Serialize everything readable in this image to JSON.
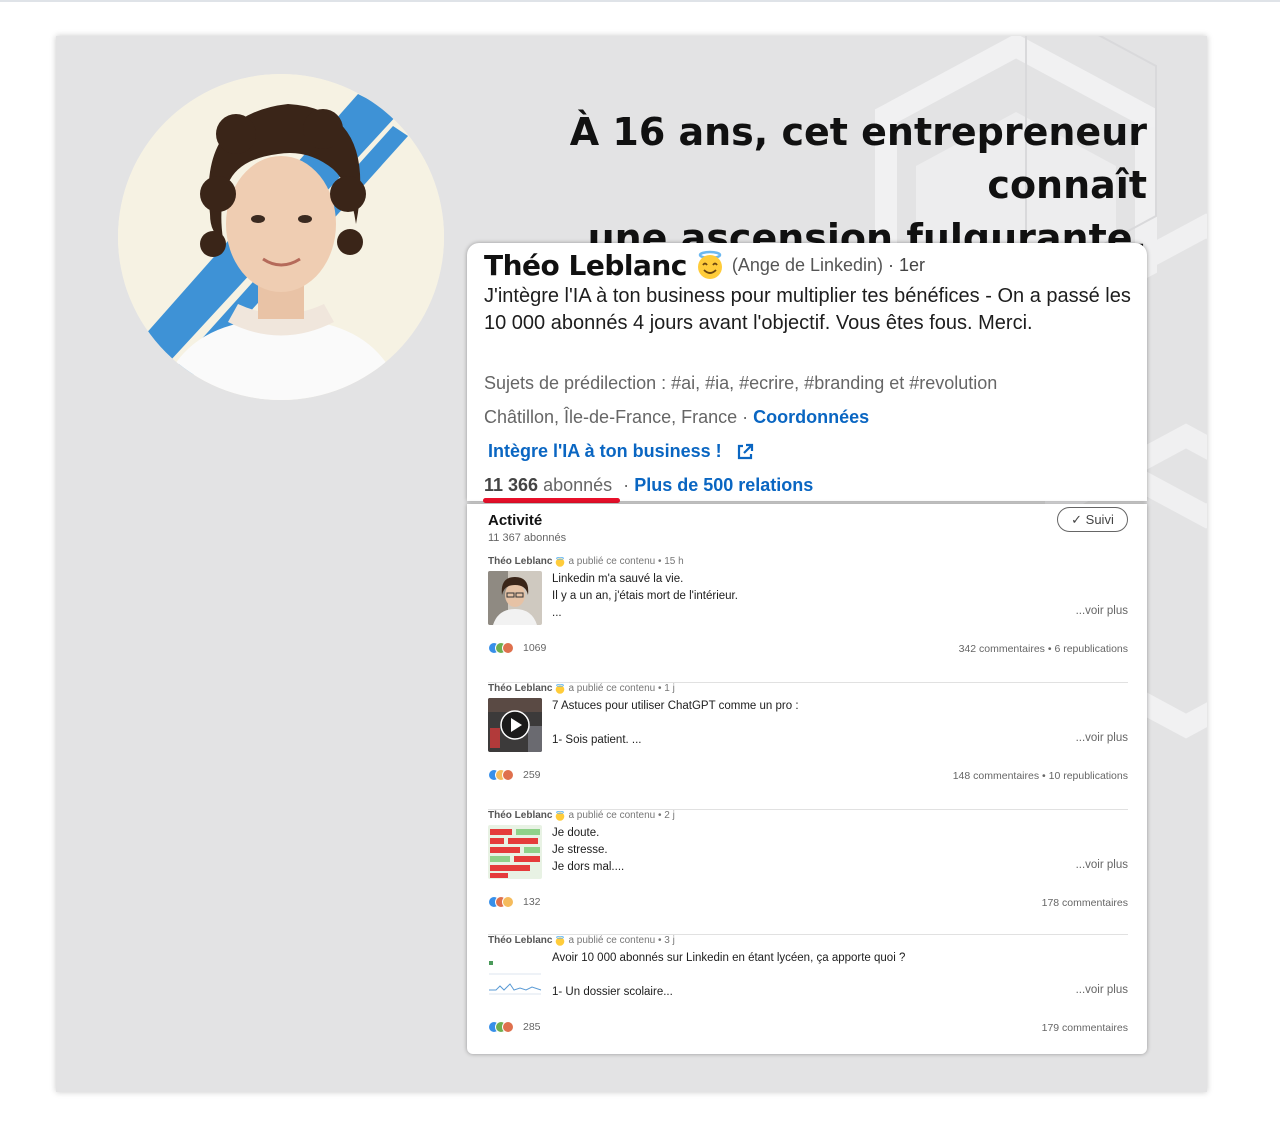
{
  "headline": {
    "line1": "À 16 ans, cet entrepreneur connaît",
    "line2": "une ascension fulgurante."
  },
  "profile": {
    "name": "Théo Leblanc",
    "name_emoji": "smiling-face-with-halo-icon",
    "nickname": "(Ange de Linkedin)",
    "degree": "· 1er",
    "headline_text": "J'intègre l'IA à ton business pour multiplier tes bénéfices - On a passé les 10 000 abonnés 4 jours avant l'objectif. Vous êtes fous. Merci.",
    "topics": "Sujets de prédilection : #ai, #ia, #ecrire, #branding et #revolution",
    "location": "Châtillon, Île-de-France, France ·",
    "contact_link": "Coordonnées",
    "website_link": "Intègre l'IA à ton business !",
    "followers_number": "11 366",
    "followers_label": "abonnés",
    "separator": "·",
    "relations": "Plus de 500 relations"
  },
  "activity": {
    "title": "Activité",
    "followers": "11 367 abonnés",
    "follow_button": "✓ Suivi",
    "posts": [
      {
        "author": "Théo Leblanc",
        "action": "a publié ce contenu",
        "time": "• 15 h",
        "lines": [
          "Linkedin m'a sauvé la vie.",
          "Il y a un an, j'étais mort de l'intérieur.",
          "..."
        ],
        "see_more": "...voir plus",
        "reaction_count": "1069",
        "stats": "342 commentaires • 6 republications"
      },
      {
        "author": "Théo Leblanc",
        "action": "a publié ce contenu",
        "time": "• 1 j",
        "lines": [
          "7 Astuces pour utiliser ChatGPT comme un pro :",
          "",
          "1- Sois patient. ..."
        ],
        "see_more": "...voir plus",
        "reaction_count": "259",
        "stats": "148 commentaires • 10 republications"
      },
      {
        "author": "Théo Leblanc",
        "action": "a publié ce contenu",
        "time": "• 2 j",
        "lines": [
          "Je doute.",
          "Je stresse.",
          "Je dors mal...."
        ],
        "see_more": "...voir plus",
        "reaction_count": "132",
        "stats": "178 commentaires"
      },
      {
        "author": "Théo Leblanc",
        "action": "a publié ce contenu",
        "time": "• 3 j",
        "lines": [
          "Avoir 10 000 abonnés sur Linkedin en étant lycéen, ça apporte quoi ?",
          "",
          "1- Un dossier scolaire..."
        ],
        "see_more": "...voir plus",
        "reaction_count": "285",
        "stats": "179 commentaires"
      }
    ]
  },
  "colors": {
    "linkedin_blue": "#0a66c2",
    "underline_red": "#e8102a",
    "background_gray": "#e3e3e4"
  }
}
